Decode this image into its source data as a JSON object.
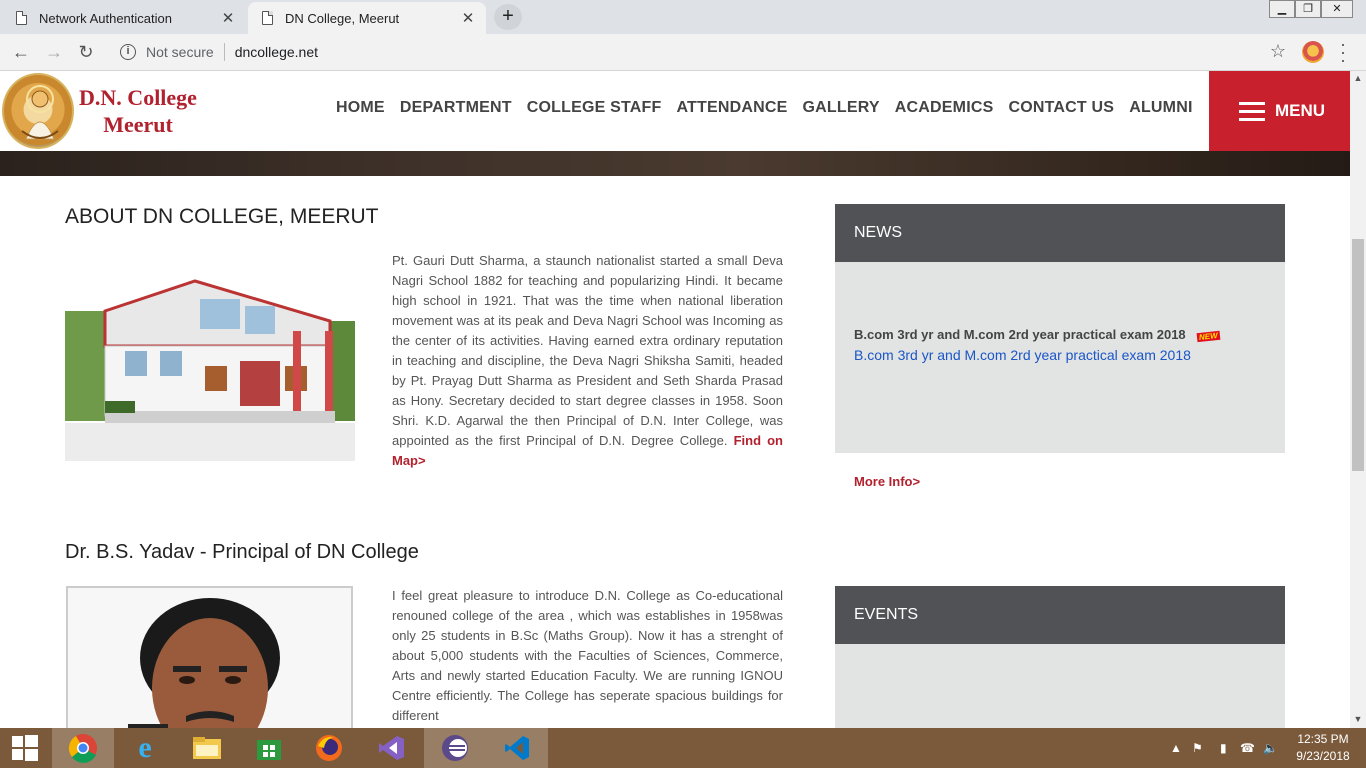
{
  "browser": {
    "tabs": [
      {
        "label": "Network Authentication",
        "active": false
      },
      {
        "label": "DN College, Meerut",
        "active": true
      }
    ],
    "security_label": "Not secure",
    "url": "dncollege.net"
  },
  "site": {
    "logo_line1": "D.N. College",
    "logo_line2": "Meerut",
    "nav": [
      "HOME",
      "DEPARTMENT",
      "COLLEGE STAFF",
      "ATTENDANCE",
      "GALLERY",
      "ACADEMICS",
      "CONTACT US",
      "ALUMNI"
    ],
    "menu_label": "MENU",
    "brand_color": "#c8202c"
  },
  "about": {
    "title": "ABOUT DN COLLEGE, MEERUT",
    "text": "Pt. Gauri Dutt Sharma, a staunch nationalist started a small Deva Nagri School 1882 for teaching and popularizing Hindi. It became high school in 1921. That was the time when national liberation movement was at its peak and Deva Nagri School was Incoming as the center of its activities. Having earned extra ordinary reputation in teaching and discipline, the Deva Nagri Shiksha Samiti, headed by Pt. Prayag Dutt Sharma as President and Seth Sharda Prasad as Hony. Secretary decided to start degree classes in 1958. Soon Shri. K.D. Agarwal the then Principal of D.N. Inter College, was appointed as the first Principal of D.N. Degree College.",
    "map_link": "Find on Map>"
  },
  "principal": {
    "title": "Dr. B.S. Yadav - Principal of DN College",
    "text": "I feel great pleasure to introduce D.N. College as Co-educational renouned college of the area , which was establishes in 1958was only 25 students in B.Sc (Maths Group). Now it has a strenght of about 5,000 students with the Faculties of Sciences, Commerce, Arts and newly started Education Faculty. We are running IGNOU Centre efficiently. The College has seperate spacious buildings for different"
  },
  "news": {
    "heading": "NEWS",
    "bold_item": "B.com 3rd yr and M.com 2rd year practical exam 2018",
    "badge": "NEW",
    "link_item": "B.com 3rd yr and M.com 2rd year practical exam 2018",
    "more": "More Info>"
  },
  "events": {
    "heading": "EVENTS"
  },
  "taskbar": {
    "time": "12:35 PM",
    "date": "9/23/2018",
    "apps": [
      "windows-start",
      "chrome",
      "internet-explorer",
      "file-explorer",
      "store",
      "firefox",
      "visual-studio",
      "eclipse",
      "vscode"
    ]
  }
}
